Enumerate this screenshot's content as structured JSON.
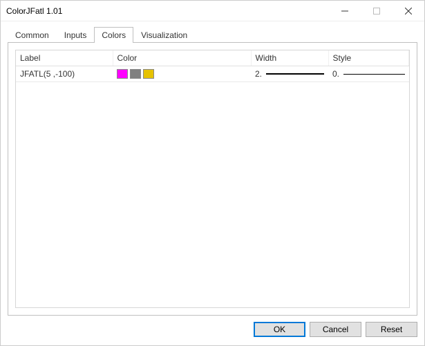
{
  "window": {
    "title": "ColorJFatl 1.01"
  },
  "tabs": {
    "items": [
      {
        "label": "Common"
      },
      {
        "label": "Inputs"
      },
      {
        "label": "Colors",
        "active": true
      },
      {
        "label": "Visualization"
      }
    ]
  },
  "table": {
    "headers": {
      "label": "Label",
      "color": "Color",
      "width": "Width",
      "style": "Style"
    },
    "rows": [
      {
        "label": "JFATL(5 ,-100)",
        "colors": [
          "#ff00ff",
          "#808080",
          "#e6c200"
        ],
        "width_text": "2.",
        "style_text": "0."
      }
    ]
  },
  "buttons": {
    "ok": "OK",
    "cancel": "Cancel",
    "reset": "Reset"
  }
}
